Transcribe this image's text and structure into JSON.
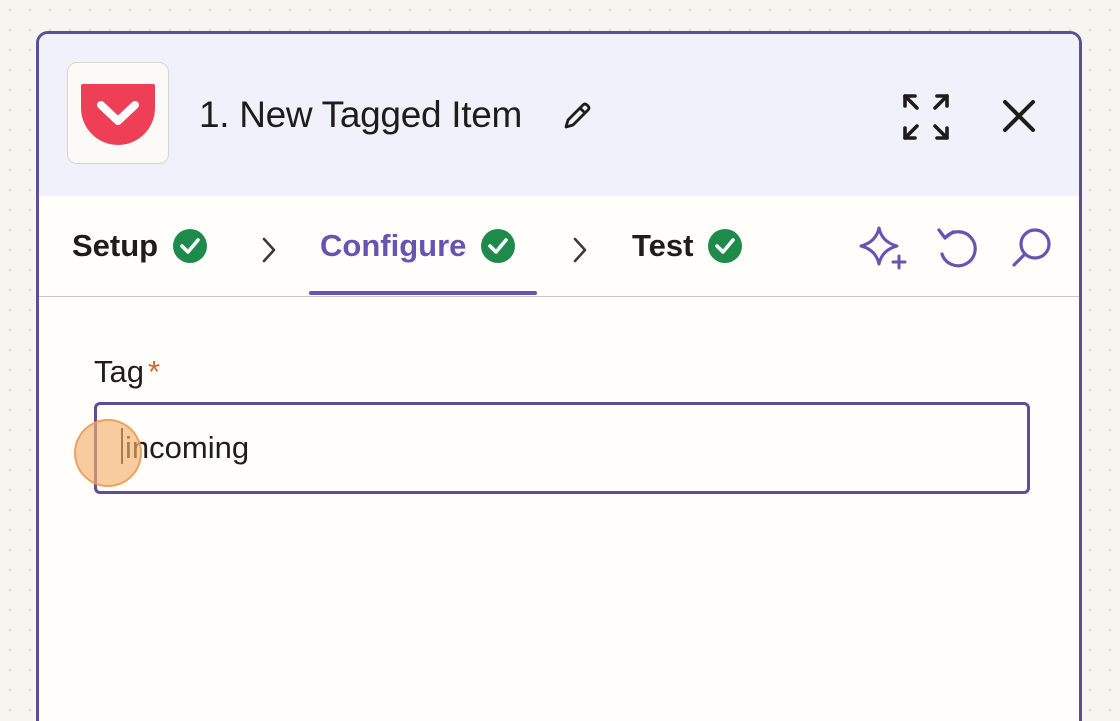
{
  "header": {
    "title": "1. New Tagged Item",
    "app_icon": "pocket-icon",
    "brand_color": "#ef3f56"
  },
  "tabs": [
    {
      "label": "Setup",
      "status": "complete"
    },
    {
      "label": "Configure",
      "status": "complete",
      "active": true
    },
    {
      "label": "Test",
      "status": "complete"
    }
  ],
  "toolbar": {
    "icons": [
      "sparkle-icon",
      "undo-icon",
      "search-icon"
    ]
  },
  "form": {
    "tag_label": "Tag",
    "required_mark": "*",
    "tag_value": "incoming"
  },
  "colors": {
    "accent": "#6754b2",
    "success": "#1e8a4c",
    "panel_border": "#5b4f96"
  }
}
